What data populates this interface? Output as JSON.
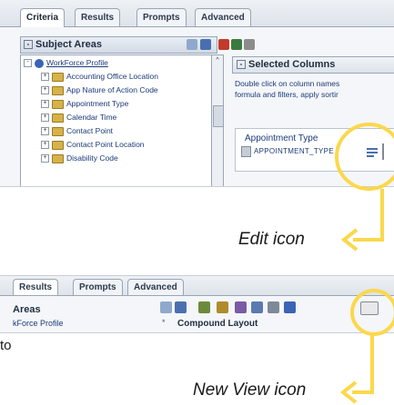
{
  "top_panel": {
    "tabs": [
      "Criteria",
      "Results",
      "Prompts",
      "Advanced"
    ],
    "subject_areas_title": "Subject Areas",
    "tree_root": "WorkForce Profile",
    "tree_items": [
      "Accounting Office Location",
      "App Nature of Action Code",
      "Appointment Type",
      "Calendar Time",
      "Contact Point",
      "Contact Point Location",
      "Disability Code"
    ],
    "selected_columns_title": "Selected Columns",
    "help_lines": [
      "Double click on column names",
      "formula and filters, apply sortir"
    ],
    "column_label": "Appointment Type",
    "column_field": "APPOINTMENT_TYPE"
  },
  "callouts": {
    "edit_icon": "Edit icon",
    "new_view_icon": "New View icon",
    "partial_text": "to",
    "color": "#fbd84b"
  },
  "bottom_panel": {
    "tabs": [
      "Results",
      "Prompts",
      "Advanced"
    ],
    "areas_label": "Areas",
    "workforce_label": "kForce Profile",
    "compound_layout": "Compound Layout"
  },
  "icons": {
    "tree_root": "workforce-globe-icon",
    "folder": "folder-icon",
    "edit": "edit-icon",
    "new_view": "new-view-icon"
  }
}
